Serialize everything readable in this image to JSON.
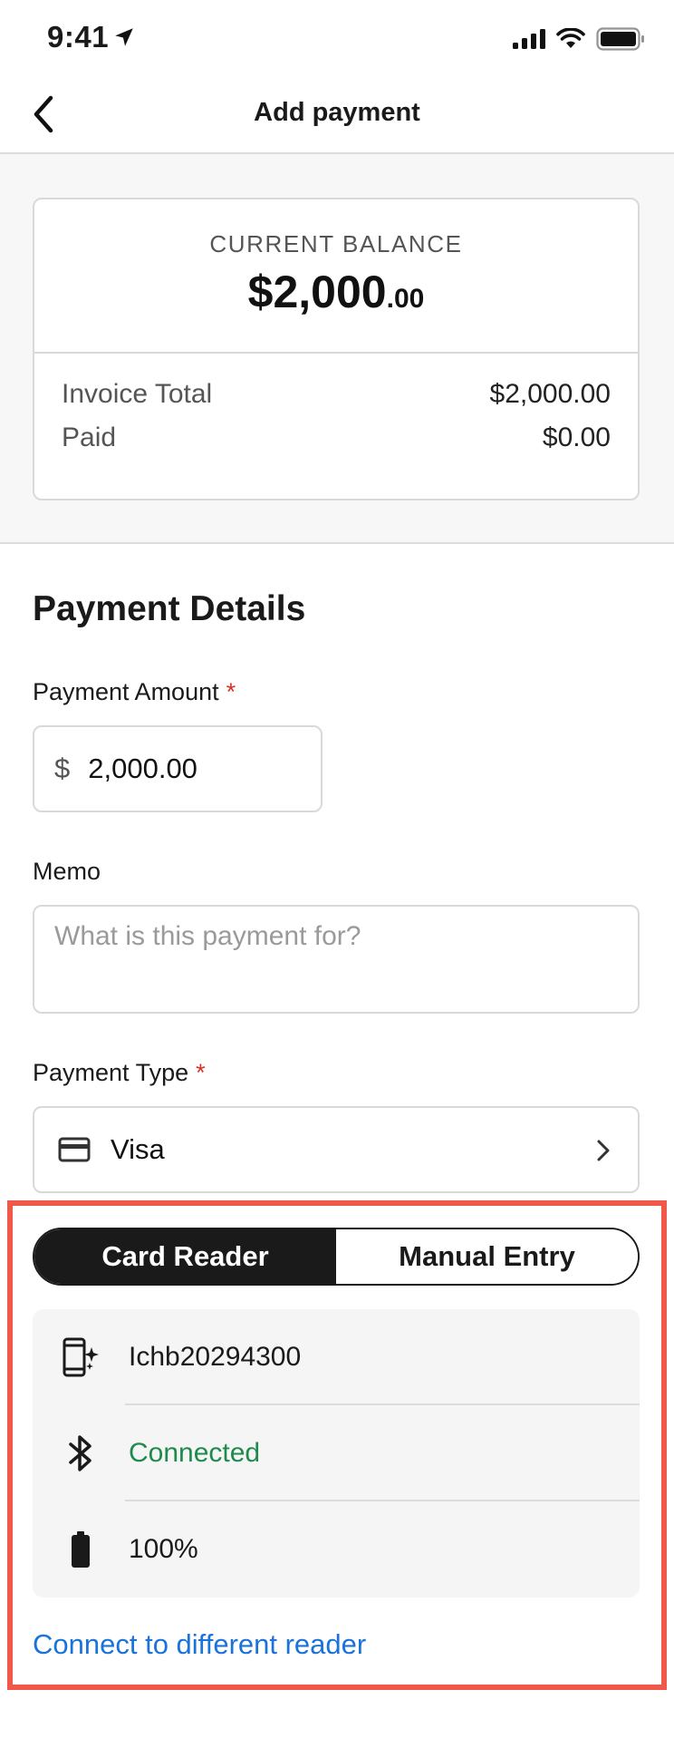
{
  "status_bar": {
    "time": "9:41"
  },
  "header": {
    "title": "Add payment"
  },
  "balance": {
    "label": "CURRENT BALANCE",
    "amount_main": "$2,000",
    "amount_cents": ".00",
    "rows": [
      {
        "label": "Invoice Total",
        "value": "$2,000.00"
      },
      {
        "label": "Paid",
        "value": "$0.00"
      }
    ]
  },
  "payment_details": {
    "title": "Payment Details",
    "amount": {
      "label": "Payment Amount",
      "required": "*",
      "currency": "$",
      "value": "2,000.00"
    },
    "memo": {
      "label": "Memo",
      "placeholder": "What is this payment for?"
    },
    "payment_type": {
      "label": "Payment Type",
      "required": "*",
      "value": "Visa"
    }
  },
  "reader": {
    "tabs": [
      {
        "label": "Card Reader",
        "active": true
      },
      {
        "label": "Manual Entry",
        "active": false
      }
    ],
    "device_name": "Ichb20294300",
    "status": "Connected",
    "battery": "100%",
    "connect_link": "Connect to different reader"
  },
  "colors": {
    "highlight_border": "#f0584a",
    "connected": "#1e8a4c",
    "link": "#1a73d9",
    "required": "#d93025"
  }
}
